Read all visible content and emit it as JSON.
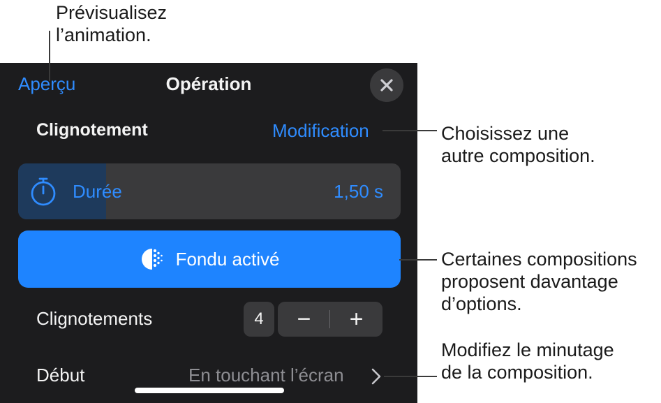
{
  "callouts": {
    "preview": [
      "Prévisualisez",
      "l’animation."
    ],
    "change": [
      "Choisissez une",
      "autre composition."
    ],
    "options": [
      "Certaines compositions",
      "proposent davantage",
      "d’options."
    ],
    "timing": [
      "Modifiez le minutage",
      "de la composition."
    ]
  },
  "panel": {
    "preview_label": "Aperçu",
    "title": "Opération",
    "close_icon": "xmark",
    "effect_name": "Clignotement",
    "change_label": "Modification",
    "duration": {
      "label": "Durée",
      "value": "1,50 s",
      "fill_fraction": 0.23,
      "icon": "stopwatch-icon"
    },
    "fade_button": {
      "label": "Fondu activé",
      "icon": "dissolve-icon"
    },
    "flashes": {
      "label": "Clignotements",
      "value": "4",
      "minus": "−",
      "plus": "+"
    },
    "start": {
      "label": "Début",
      "value": "En touchant l’écran",
      "icon": "chevron-right-icon"
    }
  },
  "colors": {
    "accent": "#2f8cff",
    "button": "#1e84ff",
    "panel_bg": "#1c1c1e",
    "control_bg": "#3a3a3c"
  }
}
